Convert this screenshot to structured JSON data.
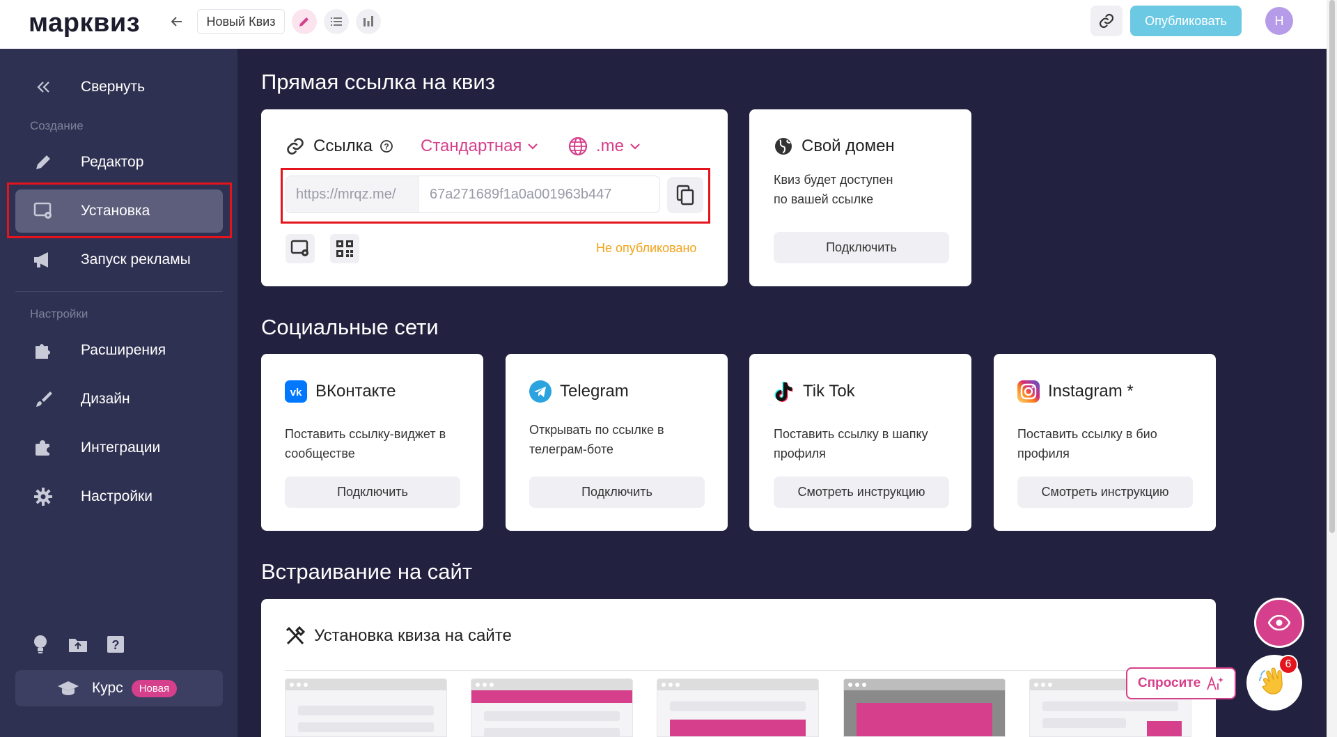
{
  "app": {
    "logo": "марквиз",
    "quiz_title": "Новый Квиз",
    "publish_label": "Опубликовать",
    "avatar_letter": "Н"
  },
  "sidebar": {
    "collapse_label": "Свернуть",
    "section_create": "Создание",
    "section_settings": "Настройки",
    "items": [
      {
        "label": "Редактор",
        "icon": "pencil-icon"
      },
      {
        "label": "Установка",
        "icon": "install-icon",
        "active": true
      },
      {
        "label": "Запуск рекламы",
        "icon": "megaphone-icon"
      },
      {
        "label": "Расширения",
        "icon": "puzzle-icon"
      },
      {
        "label": "Дизайн",
        "icon": "brush-icon"
      },
      {
        "label": "Интеграции",
        "icon": "integrations-icon"
      },
      {
        "label": "Настройки",
        "icon": "gear-icon"
      }
    ],
    "course_label": "Курс",
    "course_badge": "Новая"
  },
  "direct_link": {
    "heading": "Прямая ссылка на квиз",
    "title": "Ссылка",
    "type_label": "Стандартная",
    "domain_label": ".me",
    "url_prefix": "https://mrqz.me/",
    "url_value": "67a271689f1a0a001963b447",
    "status": "Не опубликовано"
  },
  "own_domain": {
    "title": "Свой домен",
    "text_line1": "Квиз будет доступен",
    "text_line2": "по вашей ссылке",
    "button": "Подключить"
  },
  "social": {
    "heading": "Социальные сети",
    "cards": [
      {
        "title": "ВКонтакте",
        "line1": "Поставить ссылку-виджет в",
        "line2": "сообществе",
        "button": "Подключить"
      },
      {
        "title": "Telegram",
        "line1": "Открывать по ссылке в",
        "line2": "телеграм-боте",
        "button": "Подключить"
      },
      {
        "title": "Tik Tok",
        "line1": "Поставить ссылку в шапку",
        "line2": "профиля",
        "button": "Смотреть инструкцию"
      },
      {
        "title": "Instagram *",
        "line1": "Поставить ссылку в био",
        "line2": "профиля",
        "button": "Смотреть инструкцию"
      }
    ]
  },
  "embed": {
    "heading": "Встраивание на сайт",
    "title": "Установка квиза на сайте"
  },
  "floats": {
    "ask_label": "Спросите",
    "notif_count": "6"
  },
  "colors": {
    "accent": "#d63f8b",
    "publish": "#6cc9e4",
    "sidebar": "#2f3152",
    "background": "#222240",
    "warning": "#f0a318",
    "highlight": "#e3141c"
  }
}
